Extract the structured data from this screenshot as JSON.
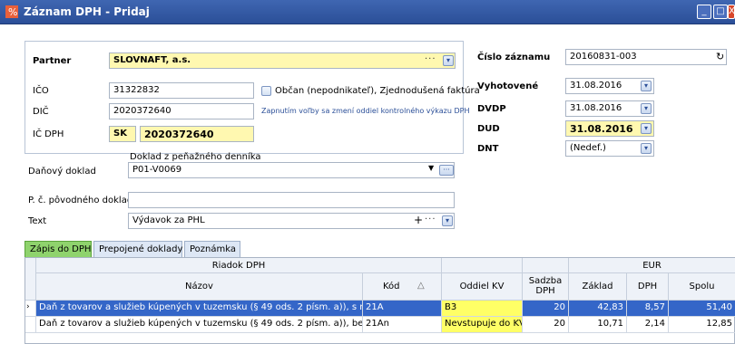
{
  "window": {
    "title": "Záznam DPH - Pridaj"
  },
  "partner": {
    "label": "Partner",
    "value": "SLOVNAFT, a.s.",
    "ico_label": "IČO",
    "ico": "31322832",
    "dic_label": "DIČ",
    "dic": "2020372640",
    "icdph_label": "IČ DPH",
    "icdph_country": "SK",
    "icdph_number": "2020372640",
    "citizen_checkbox_label": "Občan (nepodnikateľ), Zjednodušená faktúra",
    "note": "Zapnutím voľby sa zmení oddiel kontrolného výkazu DPH"
  },
  "record": {
    "cislo_label": "Číslo záznamu",
    "cislo": "20160831-003",
    "vyhotovene_label": "Vyhotovené",
    "vyhotovene": "31.08.2016",
    "dvdp_label": "DVDP",
    "dvdp": "31.08.2016",
    "dud_label": "DUD",
    "dud": "31.08.2016",
    "dnt_label": "DNT",
    "dnt": "(Nedef.)"
  },
  "doc": {
    "source_label": "Doklad z peňažného denníka",
    "danovy_label": "Daňový doklad",
    "danovy": "P01-V0069",
    "povodny_label": "P. č. pôvodného dokladu",
    "povodny": "",
    "text_label": "Text",
    "text": "Výdavok za PHL"
  },
  "tabs": [
    "Zápis do DPH",
    "Prepojené doklady",
    "Poznámka"
  ],
  "grid": {
    "group_riadok": "Riadok DPH",
    "group_eur": "EUR",
    "columns": {
      "nazov": "Názov",
      "kod": "Kód",
      "oddiel": "Oddiel KV",
      "sadzba": "Sadzba DPH",
      "zaklad": "Základ",
      "dph": "DPH",
      "spolu": "Spolu"
    },
    "rows": [
      {
        "nazov": "Daň z tovarov a služieb kúpených v tuzemsku (§ 49 ods. 2 písm. a)), s možnosťou odp",
        "kod": "21A",
        "oddiel": "B3",
        "sadzba": "20",
        "zaklad": "42,83",
        "dph": "8,57",
        "spolu": "51,40"
      },
      {
        "nazov": "Daň z tovarov a služieb kúpených v tuzemsku (§ 49 ods. 2 písm. a)), bez možnosti odp",
        "kod": "21An",
        "oddiel": "Nevstupuje do KV",
        "sadzba": "20",
        "zaklad": "10,71",
        "dph": "2,14",
        "spolu": "12,85"
      }
    ]
  },
  "colors": {
    "titlebar": "#2b4f98",
    "selected_row": "#3466c8",
    "highlight": "#ffff66",
    "active_tab": "#8fd36d"
  }
}
